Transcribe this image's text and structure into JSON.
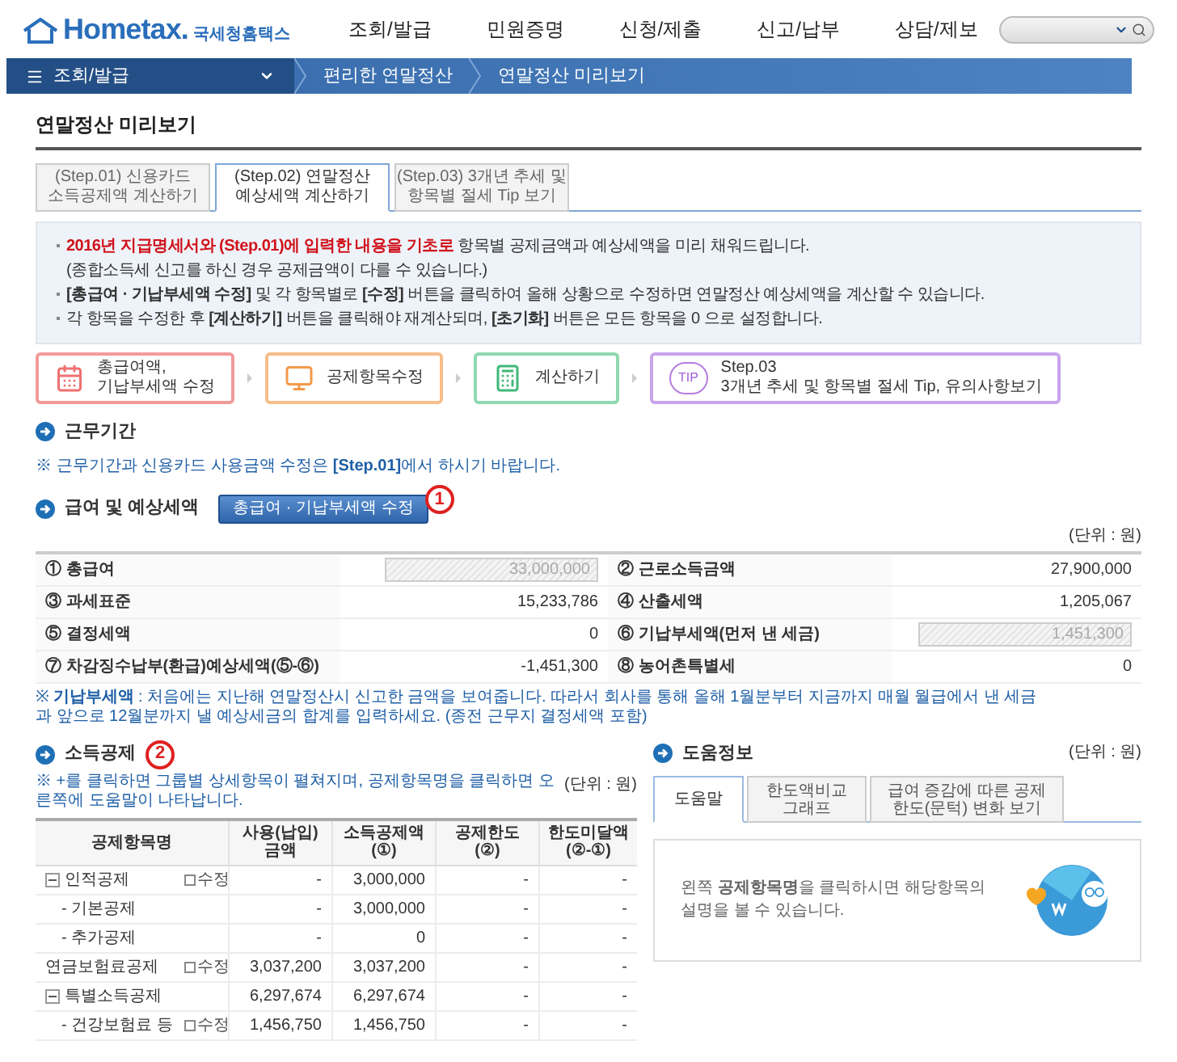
{
  "header": {
    "logo": "Hometax.",
    "logo_subtitle": "국세청홈택스",
    "nav": [
      "조회/발급",
      "민원증명",
      "신청/제출",
      "신고/납부",
      "상담/제보"
    ]
  },
  "breadcrumb": {
    "menu": "조회/발급",
    "items": [
      "편리한 연말정산",
      "연말정산 미리보기"
    ]
  },
  "page_title": "연말정산 미리보기",
  "step_tabs": [
    {
      "label": "(Step.01) 신용카드\n소득공제액 계산하기",
      "selected": false
    },
    {
      "label": "(Step.02) 연말정산\n예상세액 계산하기",
      "selected": true
    },
    {
      "label": "(Step.03) 3개년 추세 및\n항목별 절세 Tip 보기",
      "selected": false
    }
  ],
  "info": [
    {
      "highlight": "2016년 지급명세서와 (Step.01)에 입력한 내용을 기초로",
      "text": " 항목별 공제금액과 예상세액을 미리 채워드립니다.",
      "sub": "(종합소득세 신고를 하신 경우 공제금액이 다를 수 있습니다.)"
    },
    {
      "text": "**[총급여 · 기납부세액 수정]** 및 각 항목별로 **[수정]** 버튼을 클릭하여 올해 상황으로 수정하면 연말정산 예상세액을 계산할 수 있습니다."
    },
    {
      "text": "각 항목을 수정한 후 **[계산하기]** 버튼을 클릭해야 재계산되며, **[초기화]** 버튼은 모든 항목을 0 으로 설정합니다."
    }
  ],
  "flow": [
    {
      "kind": "calendar",
      "label": "총급여액,\n기납부세액 수정",
      "color": "#f29a9a"
    },
    {
      "kind": "monitor",
      "label": "공제항목수정",
      "color": "#f7bd8a"
    },
    {
      "kind": "calculator",
      "label": "계산하기",
      "color": "#8fd9b0"
    },
    {
      "kind": "tip",
      "icon_text": "TIP",
      "label": "Step.03\n3개년 추세 및 항목별 절세 Tip, 유의사항보기",
      "color": "#c9a3ec"
    }
  ],
  "work_period": {
    "title": "근무기간",
    "note": "※ 근무기간과 신용카드 사용금액 수정은 **[Step.01]**에서 하시기 바랍니다."
  },
  "salary": {
    "title": "급여 및 예상세액",
    "button": "총급여 · 기납부세액 수정",
    "badge": "1",
    "unit": "(단위 : 원)",
    "items": [
      {
        "label": "① 총급여",
        "value": "33,000,000",
        "kind": "input"
      },
      {
        "label": "② 근로소득금액",
        "value": "27,900,000",
        "kind": "text"
      },
      {
        "label": "③ 과세표준",
        "value": "15,233,786",
        "kind": "text"
      },
      {
        "label": "④ 산출세액",
        "value": "1,205,067",
        "kind": "text"
      },
      {
        "label": "⑤ 결정세액",
        "value": "0",
        "kind": "text"
      },
      {
        "label": "⑥ 기납부세액(먼저 낸 세금)",
        "value": "1,451,300",
        "kind": "input"
      },
      {
        "label": "⑦ 차감징수납부(환급)예상세액(⑤-⑥)",
        "value": "-1,451,300",
        "kind": "text"
      },
      {
        "label": "⑧ 농어촌특별세",
        "value": "0",
        "kind": "text"
      }
    ],
    "note": "※ **기납부세액** : 처음에는 지난해 연말정산시 신고한 금액을 보여줍니다. 따라서 회사를 통해 올해 1월분부터 지금까지 매월 월급에서 낸 세금과 앞으로 12월분까지 낼 예상세금의 합계를 입력하세요. (종전 근무지 결정세액 포함)"
  },
  "deduction": {
    "title": "소득공제",
    "badge": "2",
    "note": "※ +를 클릭하면 그룹별 상세항목이 펼쳐지며, 공제항목명을 클릭하면 오른쪽에 도움말이 나타납니다.",
    "unit": "(단위 : 원)",
    "columns": [
      "공제항목명",
      "사용(납입)\n금액",
      "소득공제액\n(①)",
      "공제한도\n(②)",
      "한도미달액\n(②-①)"
    ],
    "rows": [
      {
        "name": "인적공제",
        "expanded": true,
        "edit": "수정",
        "values": [
          "-",
          "3,000,000",
          "-",
          "-"
        ],
        "children": [
          {
            "name": "- 기본공제",
            "values": [
              "-",
              "3,000,000",
              "-",
              "-"
            ]
          },
          {
            "name": "- 추가공제",
            "values": [
              "-",
              "0",
              "-",
              "-"
            ]
          }
        ]
      },
      {
        "name": "연금보험료공제",
        "expanded": false,
        "edit": "수정",
        "values": [
          "3,037,200",
          "3,037,200",
          "-",
          "-"
        ]
      },
      {
        "name": "특별소득공제",
        "expanded": true,
        "values": [
          "6,297,674",
          "6,297,674",
          "-",
          "-"
        ],
        "children": [
          {
            "name": "- 건강보험료 등",
            "edit": "수정",
            "values": [
              "1,456,750",
              "1,456,750",
              "-",
              "-"
            ]
          }
        ]
      }
    ]
  },
  "help": {
    "title": "도움정보",
    "unit": "(단위 : 원)",
    "tabs": [
      {
        "label": "도움말",
        "selected": true
      },
      {
        "label": "한도액비교\n그래프",
        "selected": false
      },
      {
        "label": "급여 증감에 따른 공제\n한도(문턱) 변화 보기",
        "selected": false
      }
    ],
    "text": "왼쪽 **공제항목명**을 클릭하시면 해당항목의 설명을 볼 수 있습니다."
  }
}
